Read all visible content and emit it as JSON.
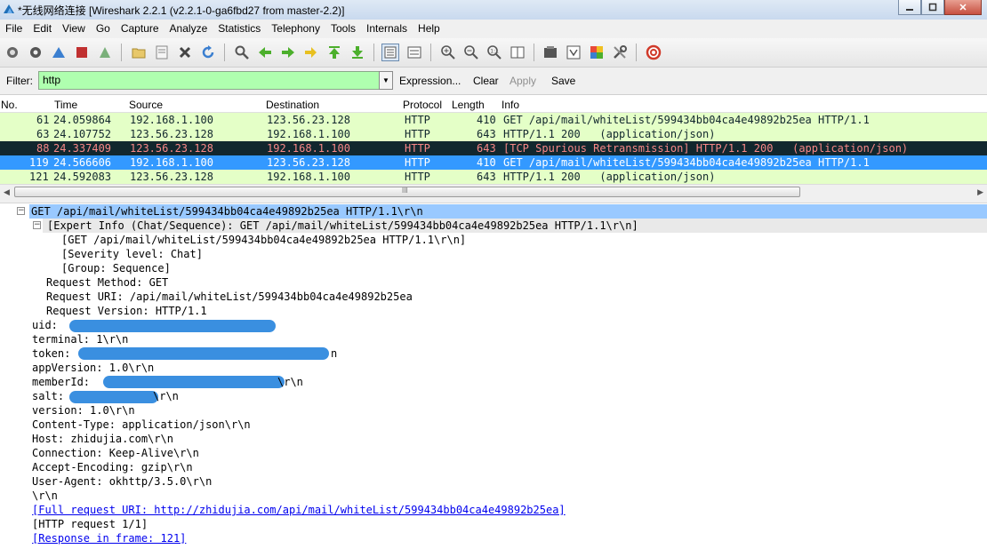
{
  "window": {
    "title": "*无线网络连接 [Wireshark 2.2.1 (v2.2.1-0-ga6fbd27 from master-2.2)]"
  },
  "menu": [
    "File",
    "Edit",
    "View",
    "Go",
    "Capture",
    "Analyze",
    "Statistics",
    "Telephony",
    "Tools",
    "Internals",
    "Help"
  ],
  "filter": {
    "label": "Filter:",
    "value": "http",
    "expression": "Expression...",
    "clear": "Clear",
    "apply": "Apply",
    "save": "Save"
  },
  "columns": [
    "No.",
    "Time",
    "Source",
    "Destination",
    "Protocol",
    "Length",
    "Info"
  ],
  "packets": [
    {
      "no": "61",
      "time": "24.059864",
      "src": "192.168.1.100",
      "dst": "123.56.23.128",
      "proto": "HTTP",
      "len": "410",
      "info": "GET /api/mail/whiteList/599434bb04ca4e49892b25ea HTTP/1.1"
    },
    {
      "no": "63",
      "time": "24.107752",
      "src": "123.56.23.128",
      "dst": "192.168.1.100",
      "proto": "HTTP",
      "len": "643",
      "info": "HTTP/1.1 200   (application/json)"
    },
    {
      "no": "88",
      "time": "24.337409",
      "src": "123.56.23.128",
      "dst": "192.168.1.100",
      "proto": "HTTP",
      "len": "643",
      "info": "[TCP Spurious Retransmission] HTTP/1.1 200   (application/json)"
    },
    {
      "no": "119",
      "time": "24.566606",
      "src": "192.168.1.100",
      "dst": "123.56.23.128",
      "proto": "HTTP",
      "len": "410",
      "info": "GET /api/mail/whiteList/599434bb04ca4e49892b25ea HTTP/1.1"
    },
    {
      "no": "121",
      "time": "24.592083",
      "src": "123.56.23.128",
      "dst": "192.168.1.100",
      "proto": "HTTP",
      "len": "643",
      "info": "HTTP/1.1 200   (application/json)"
    }
  ],
  "scroll_grip": "III",
  "details": {
    "request_line": "GET /api/mail/whiteList/599434bb04ca4e49892b25ea HTTP/1.1\\r\\n",
    "expert_info": "[Expert Info (Chat/Sequence): GET /api/mail/whiteList/599434bb04ca4e49892b25ea HTTP/1.1\\r\\n]",
    "expert_children": [
      "[GET /api/mail/whiteList/599434bb04ca4e49892b25ea HTTP/1.1\\r\\n]",
      "[Severity level: Chat]",
      "[Group: Sequence]"
    ],
    "request_fields": [
      "Request Method: GET",
      "Request URI: /api/mail/whiteList/599434bb04ca4e49892b25ea",
      "Request Version: HTTP/1.1"
    ],
    "uid": "uid:",
    "terminal": "terminal: 1\\r\\n",
    "token": "token:",
    "token_tail": "n",
    "app_version": "appVersion: 1.0\\r\\n",
    "member_id": "memberId:",
    "member_tail": "\\r\\n",
    "salt": "salt:",
    "salt_tail": "\\r\\n",
    "headers": [
      "version: 1.0\\r\\n",
      "Content-Type: application/json\\r\\n",
      "Host: zhidujia.com\\r\\n",
      "Connection: Keep-Alive\\r\\n",
      "Accept-Encoding: gzip\\r\\n",
      "User-Agent: okhttp/3.5.0\\r\\n",
      "\\r\\n"
    ],
    "full_uri": "[Full request URI: http://zhidujia.com/api/mail/whiteList/599434bb04ca4e49892b25ea]",
    "http_request": "[HTTP request 1/1]",
    "response_frame": "[Response in frame: 121]"
  },
  "colors": {
    "http_row": "#e4ffc7",
    "bad_row": "#12272e",
    "bad_text": "#f78787",
    "selected_row": "#3399ff",
    "filter_bg": "#afffaf"
  }
}
